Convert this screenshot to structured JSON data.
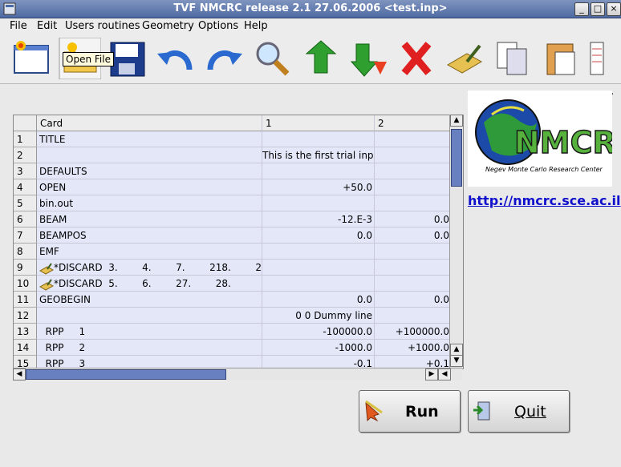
{
  "window": {
    "title": "TVF NMCRC release 2.1 27.06.2006  <test.inp>"
  },
  "menu": [
    "File",
    "Edit",
    "Users routines",
    "Geometry",
    "Options",
    "Help"
  ],
  "toolbar": {
    "tooltip": "Open File",
    "overflow": "»",
    "icons": [
      "new-file-icon",
      "open-folder-icon",
      "save-disk-icon",
      "undo-icon",
      "redo-icon",
      "search-icon",
      "move-up-icon",
      "move-down-icon",
      "delete-x-icon",
      "edit-card-icon",
      "copy-icon",
      "paste-icon",
      "notepad-icon"
    ]
  },
  "grid": {
    "headers": [
      "Card",
      "1",
      "2"
    ],
    "rows": [
      {
        "n": "1",
        "card": "TITLE",
        "c1": "",
        "c2": ""
      },
      {
        "n": "2",
        "card": "",
        "c1": "This is the first trial inpu",
        "c2": ""
      },
      {
        "n": "3",
        "card": "DEFAULTS",
        "c1": "",
        "c2": ""
      },
      {
        "n": "4",
        "card": "OPEN",
        "c1": "+50.0",
        "c2": ""
      },
      {
        "n": "5",
        "card": "bin.out",
        "c1": "",
        "c2": ""
      },
      {
        "n": "6",
        "card": "BEAM",
        "c1": "-12.E-3",
        "c2": "0.0"
      },
      {
        "n": "7",
        "card": "BEAMPOS",
        "c1": "0.0",
        "c2": "0.0"
      },
      {
        "n": "8",
        "card": "EMF",
        "c1": "",
        "c2": ""
      },
      {
        "n": "9",
        "card": "*DISCARD  3.        4.        7.        218.        2",
        "c1": "",
        "c2": "",
        "icon": true
      },
      {
        "n": "10",
        "card": "*DISCARD  5.        6.        27.        28.",
        "c1": "",
        "c2": "",
        "icon": true
      },
      {
        "n": "11",
        "card": "GEOBEGIN",
        "c1": "0.0",
        "c2": "0.0"
      },
      {
        "n": "12",
        "card": "",
        "c1": "0 0 Dummy line",
        "c2": ""
      },
      {
        "n": "13",
        "card": "  RPP     1",
        "c1": "-100000.0",
        "c2": "+100000.0"
      },
      {
        "n": "14",
        "card": "  RPP     2",
        "c1": "-1000.0",
        "c2": "+1000.0"
      },
      {
        "n": "15",
        "card": "  RPP     3",
        "c1": "-0.1",
        "c2": "+0.1"
      }
    ]
  },
  "logo": {
    "name": "NMCRC",
    "subtitle": "Negev Monte Carlo Research Center"
  },
  "link": "http://nmcrc.sce.ac.il",
  "buttons": {
    "run": "Run",
    "quit": "Quit"
  },
  "colors": {
    "titlebar": "#5b74ab",
    "cell": "#e3e7f8",
    "link": "#1010cc"
  }
}
